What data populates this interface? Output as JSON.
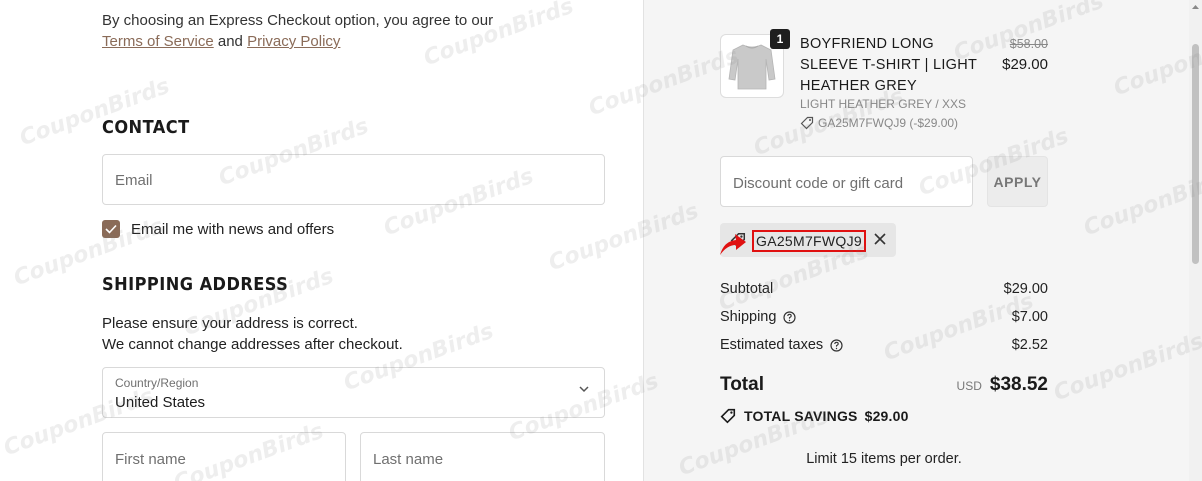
{
  "consent": {
    "text": "By choosing an Express Checkout option, you agree to our",
    "terms_link": "Terms of Service",
    "and": "and",
    "privacy_link": "Privacy Policy"
  },
  "contact": {
    "heading": "CONTACT",
    "email_placeholder": "Email",
    "newsletter_label": "Email me with news and offers",
    "newsletter_checked": true
  },
  "shipping": {
    "heading": "SHIPPING ADDRESS",
    "note_line1": "Please ensure your address is correct.",
    "note_line2": "We cannot change addresses after checkout.",
    "country_label": "Country/Region",
    "country_value": "United States",
    "first_name_placeholder": "First name",
    "last_name_placeholder": "Last name"
  },
  "order": {
    "item": {
      "quantity": "1",
      "title": "BOYFRIEND LONG SLEEVE T-SHIRT | LIGHT HEATHER GREY",
      "variant": "LIGHT HEATHER GREY / XXS",
      "discount_code": "GA25M7FWQJ9 (-$29.00)",
      "original_price": "$58.00",
      "price": "$29.00"
    },
    "discount_placeholder": "Discount code or gift card",
    "apply_label": "APPLY",
    "applied_code": "GA25M7FWQJ9",
    "subtotal_label": "Subtotal",
    "subtotal_value": "$29.00",
    "shipping_label": "Shipping",
    "shipping_value": "$7.00",
    "taxes_label": "Estimated taxes",
    "taxes_value": "$2.52",
    "total_label": "Total",
    "currency": "USD",
    "total_value": "$38.52",
    "savings_label": "TOTAL SAVINGS",
    "savings_value": "$29.00",
    "limit_text": "Limit 15 items per order."
  },
  "watermark": "CouponBirds",
  "colors": {
    "accent": "#8a6b58",
    "highlight_box": "#e01010",
    "panel_bg": "#f5f5f5"
  }
}
